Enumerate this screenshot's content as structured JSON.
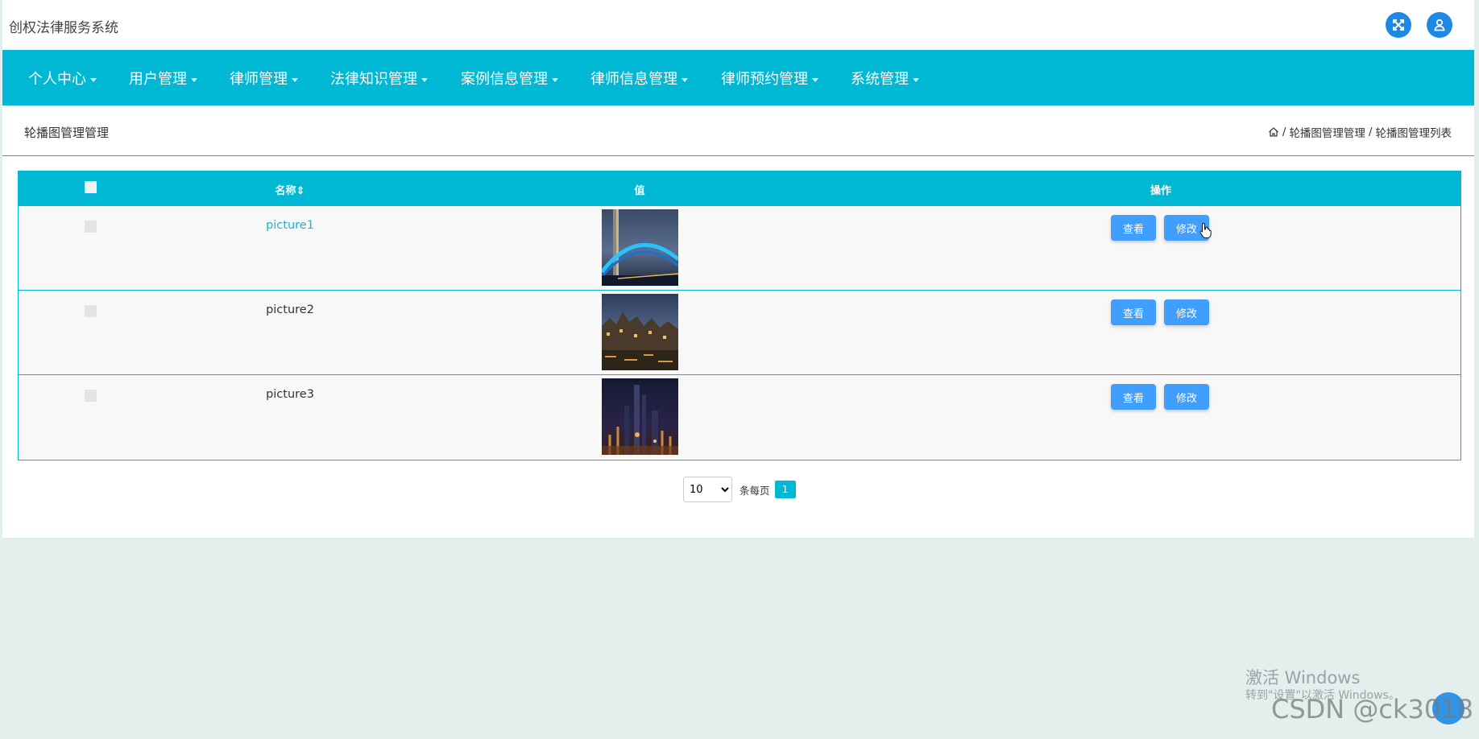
{
  "header": {
    "app_title": "创权法律服务系统",
    "icons": [
      "fullscreen-icon",
      "user-icon"
    ]
  },
  "nav": {
    "items": [
      {
        "label": "个人中心"
      },
      {
        "label": "用户管理"
      },
      {
        "label": "律师管理"
      },
      {
        "label": "法律知识管理"
      },
      {
        "label": "案例信息管理"
      },
      {
        "label": "律师信息管理"
      },
      {
        "label": "律师预约管理"
      },
      {
        "label": "系统管理"
      }
    ]
  },
  "breadcrumb": {
    "title": "轮播图管理管理",
    "home_icon": "home-icon",
    "sep": "/",
    "level1": "轮播图管理管理",
    "level2": "轮播图管理列表"
  },
  "table": {
    "columns": [
      "名称",
      "值",
      "操作"
    ],
    "sort_icon": "⇕",
    "rows": [
      {
        "name": "picture1",
        "image": "bridge-night-image",
        "view_label": "查看",
        "edit_label": "修改"
      },
      {
        "name": "picture2",
        "image": "city-waterfront-image",
        "view_label": "查看",
        "edit_label": "修改"
      },
      {
        "name": "picture3",
        "image": "night-skyline-image",
        "view_label": "查看",
        "edit_label": "修改"
      }
    ]
  },
  "pagination": {
    "page_size": "10",
    "per_page_label": "条每页",
    "current_page": "1"
  },
  "overlay": {
    "activate_title": "激活 Windows",
    "activate_sub": "转到\"设置\"以激活 Windows。",
    "csdn": "CSDN @ck3018"
  },
  "colors": {
    "accent": "#00b8d4",
    "button": "#409eff",
    "icon_button": "#1e88e5",
    "link": "#1ab5d2",
    "page_bg": "#e2efec"
  }
}
